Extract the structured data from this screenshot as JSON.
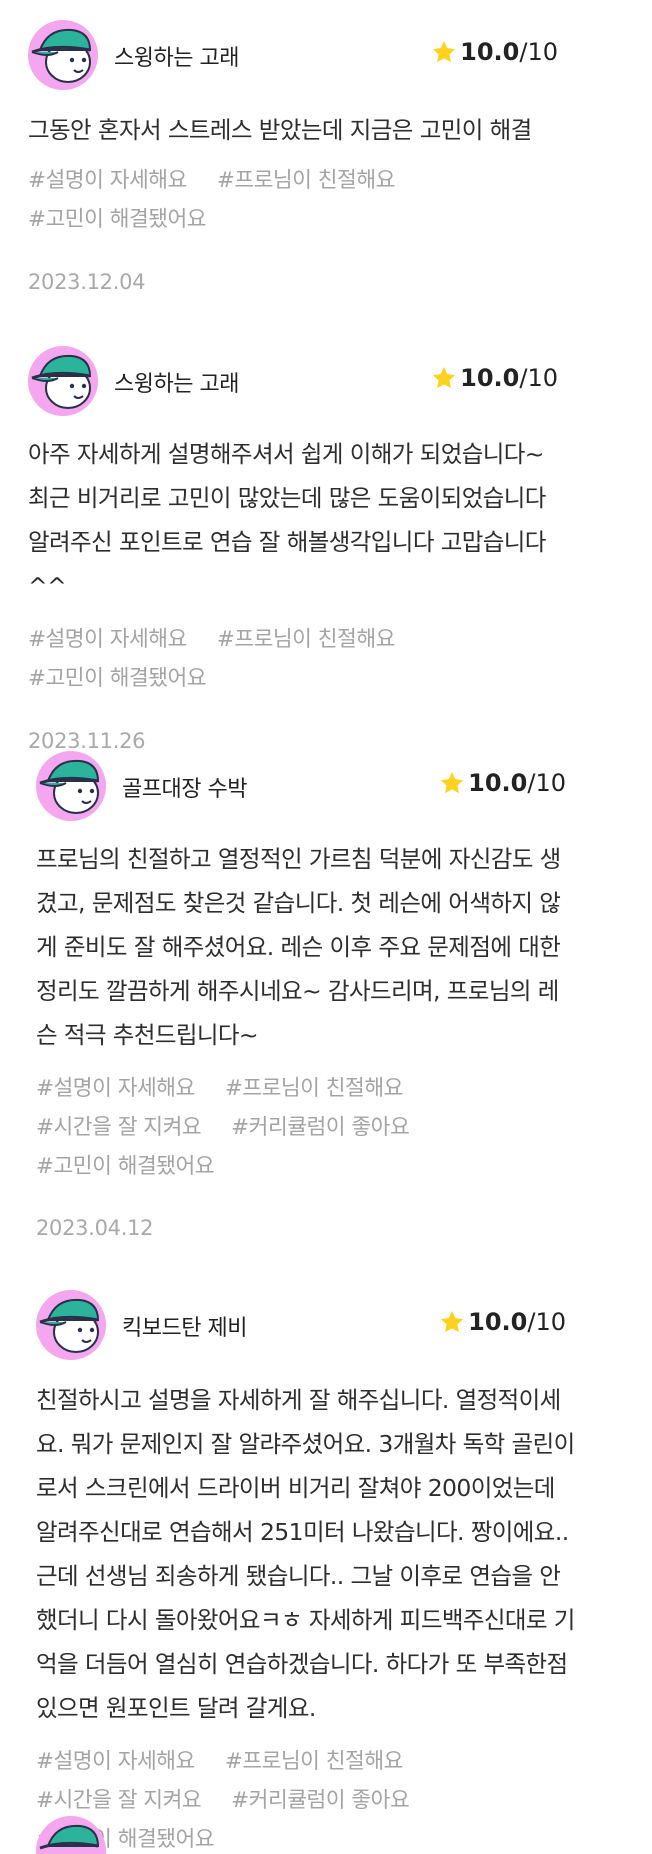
{
  "reviews": [
    {
      "nickname": "스윙하는 고래",
      "score": "10.0",
      "max": "/10",
      "lines": [
        "그동안 혼자서 스트레스 받았는데 지금은 고민이 해결"
      ],
      "tags": [
        "#설명이 자세해요",
        "#프로님이 친절해요",
        "#고민이 해결됐어요"
      ],
      "date": "2023.12.04"
    },
    {
      "nickname": "스윙하는 고래",
      "score": "10.0",
      "max": "/10",
      "lines": [
        "아주 자세하게 설명해주셔서 쉽게 이해가 되었습니다~",
        "최근 비거리로 고민이 많았는데 많은 도움이되었습니다",
        "알려주신 포인트로 연습 잘 해볼생각입니다 고맙습니다",
        "^^"
      ],
      "tags": [
        "#설명이 자세해요",
        "#프로님이 친절해요",
        "#고민이 해결됐어요"
      ],
      "date": "2023.11.26"
    },
    {
      "nickname": "골프대장 수박",
      "score": "10.0",
      "max": "/10",
      "lines": [
        "프로님의 친절하고 열정적인 가르침 덕분에 자신감도 생",
        "겼고, 문제점도 찾은것 같습니다. 첫 레슨에 어색하지 않",
        "게 준비도 잘 해주셨어요. 레슨 이후 주요 문제점에 대한",
        "정리도 깔끔하게 해주시네요~ 감사드리며, 프로님의 레",
        "슨 적극 추천드립니다~"
      ],
      "tags": [
        "#설명이 자세해요",
        "#프로님이 친절해요",
        "#시간을 잘 지켜요",
        "#커리큘럼이 좋아요",
        "#고민이 해결됐어요"
      ],
      "date": "2023.04.12"
    },
    {
      "nickname": "킥보드탄 제비",
      "score": "10.0",
      "max": "/10",
      "lines": [
        "친절하시고 설명을 자세하게 잘 해주십니다. 열정적이세",
        "요. 뭐가 문제인지 잘 알랴주셨어요. 3개월차 독학 골린이",
        "로서 스크린에서 드라이버 비거리 잘쳐야 200이었는데",
        "알려주신대로 연습해서 251미터 나왔습니다. 짱이에요..",
        "근데 선생님 죄송하게 됐습니다.. 그날 이후로 연습을 안",
        "했더니 다시 돌아왔어요ㅋㅎ 자세하게 피드백주신대로 기",
        "억을 더듬어 열심히 연습하겠습니다. 하다가 또 부족한점",
        "있으면 원포인트 달려 갈게요."
      ],
      "tags": [
        "#설명이 자세해요",
        "#프로님이 친절해요",
        "#시간을 잘 지켜요",
        "#커리큘럼이 좋아요",
        "#고민이 해결됐어요"
      ],
      "date": ""
    }
  ],
  "colors": {
    "avatar_bg": "#f4a6ee",
    "cap": "#2bb39b",
    "star": "#ffd21f"
  }
}
